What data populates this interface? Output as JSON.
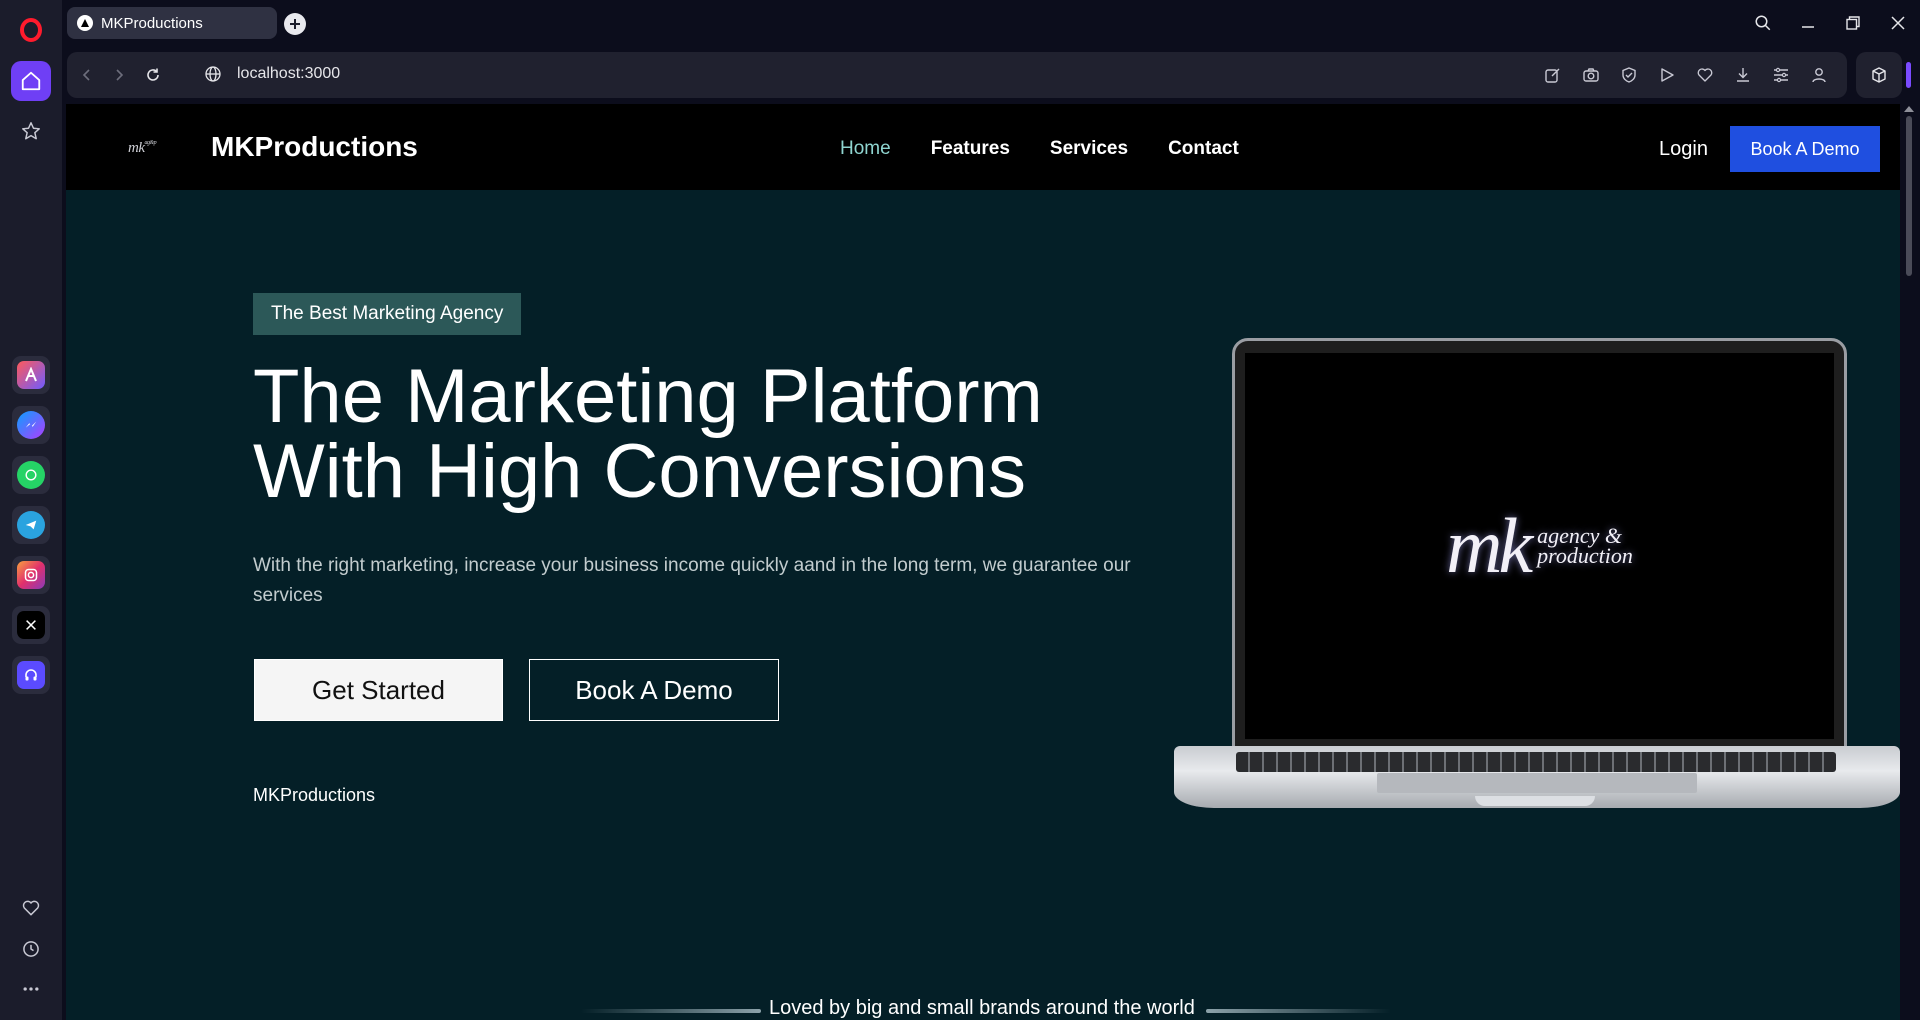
{
  "browser": {
    "tab_title": "MKProductions",
    "url": "localhost:3000"
  },
  "site": {
    "brand_logo": "mk",
    "brand_name": "MKProductions",
    "nav": [
      {
        "label": "Home",
        "active": true
      },
      {
        "label": "Features",
        "active": false
      },
      {
        "label": "Services",
        "active": false
      },
      {
        "label": "Contact",
        "active": false
      }
    ],
    "login_label": "Login",
    "header_cta": "Book A Demo"
  },
  "hero": {
    "badge": "The Best Marketing Agency",
    "title_line1": "The Marketing Platform",
    "title_line2": "With High Conversions",
    "subtitle": "With the right marketing, increase your business income quickly aand in the long term, we guarantee our services",
    "primary_cta": "Get Started",
    "secondary_cta": "Book A Demo",
    "footer_brand": "MKProductions",
    "screen_logo_main": "mk",
    "screen_logo_tag1": "agency &",
    "screen_logo_tag2": "production"
  },
  "brands": {
    "heading": "Loved by big and small brands around the world"
  },
  "colors": {
    "hero_bg": "#041f27",
    "header_bg": "#000000",
    "accent_blue": "#1f4fe0",
    "nav_active": "#8fd5d0",
    "badge_bg": "#2c5858",
    "opera_purple": "#6f3ff5"
  },
  "icons": {
    "sidebar_top": [
      "opera-logo-icon",
      "home-icon",
      "star-icon"
    ],
    "sidebar_apps": [
      "aria-icon",
      "messenger-icon",
      "whatsapp-icon",
      "telegram-icon",
      "instagram-icon",
      "x-icon",
      "music-player-icon"
    ],
    "sidebar_bottom": [
      "heart-icon",
      "history-icon",
      "more-icon"
    ],
    "toolbar": [
      "snapshot-edit-icon",
      "camera-icon",
      "shield-icon",
      "play-icon",
      "heart-icon",
      "download-icon",
      "easy-setup-icon",
      "account-icon"
    ]
  }
}
